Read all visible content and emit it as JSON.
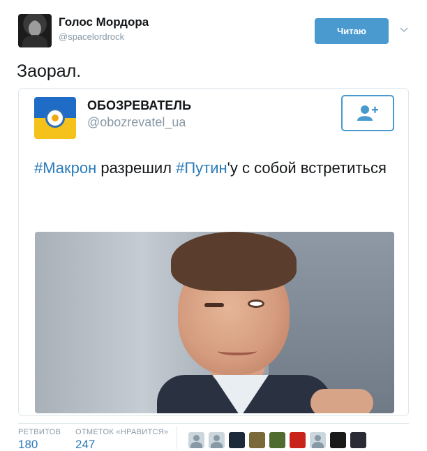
{
  "author": {
    "name": "Голос Мордора",
    "handle": "@spacelordrock"
  },
  "follow_button": {
    "label": "Читаю"
  },
  "tweet": {
    "text": "Заорал."
  },
  "quoted_tweet": {
    "name": "ОБОЗРЕВАТЕЛЬ",
    "handle": "@obozrevatel_ua",
    "text_parts": [
      "#Макрон",
      " разрешил ",
      "#Путин",
      "'у с собой встретиться"
    ]
  },
  "stats": {
    "retweets_label": "РЕТВИТОВ",
    "retweets_value": "180",
    "likes_label": "ОТМЕТОК «НРАВИТСЯ»",
    "likes_value": "247"
  },
  "likers": [
    {
      "style": "default",
      "color": "#ccd6dd"
    },
    {
      "style": "default",
      "color": "#ccd6dd"
    },
    {
      "style": "image",
      "color": "#1d2a3a"
    },
    {
      "style": "image",
      "color": "#7a6a3a"
    },
    {
      "style": "image",
      "color": "#4f6b2f"
    },
    {
      "style": "image",
      "color": "#c9241c"
    },
    {
      "style": "default",
      "color": "#ccd6dd"
    },
    {
      "style": "image",
      "color": "#1a1a1a"
    },
    {
      "style": "image",
      "color": "#2b2b36"
    }
  ],
  "colors": {
    "accent": "#4a9ad0",
    "link": "#2b7bb9",
    "muted": "#8899a6"
  }
}
